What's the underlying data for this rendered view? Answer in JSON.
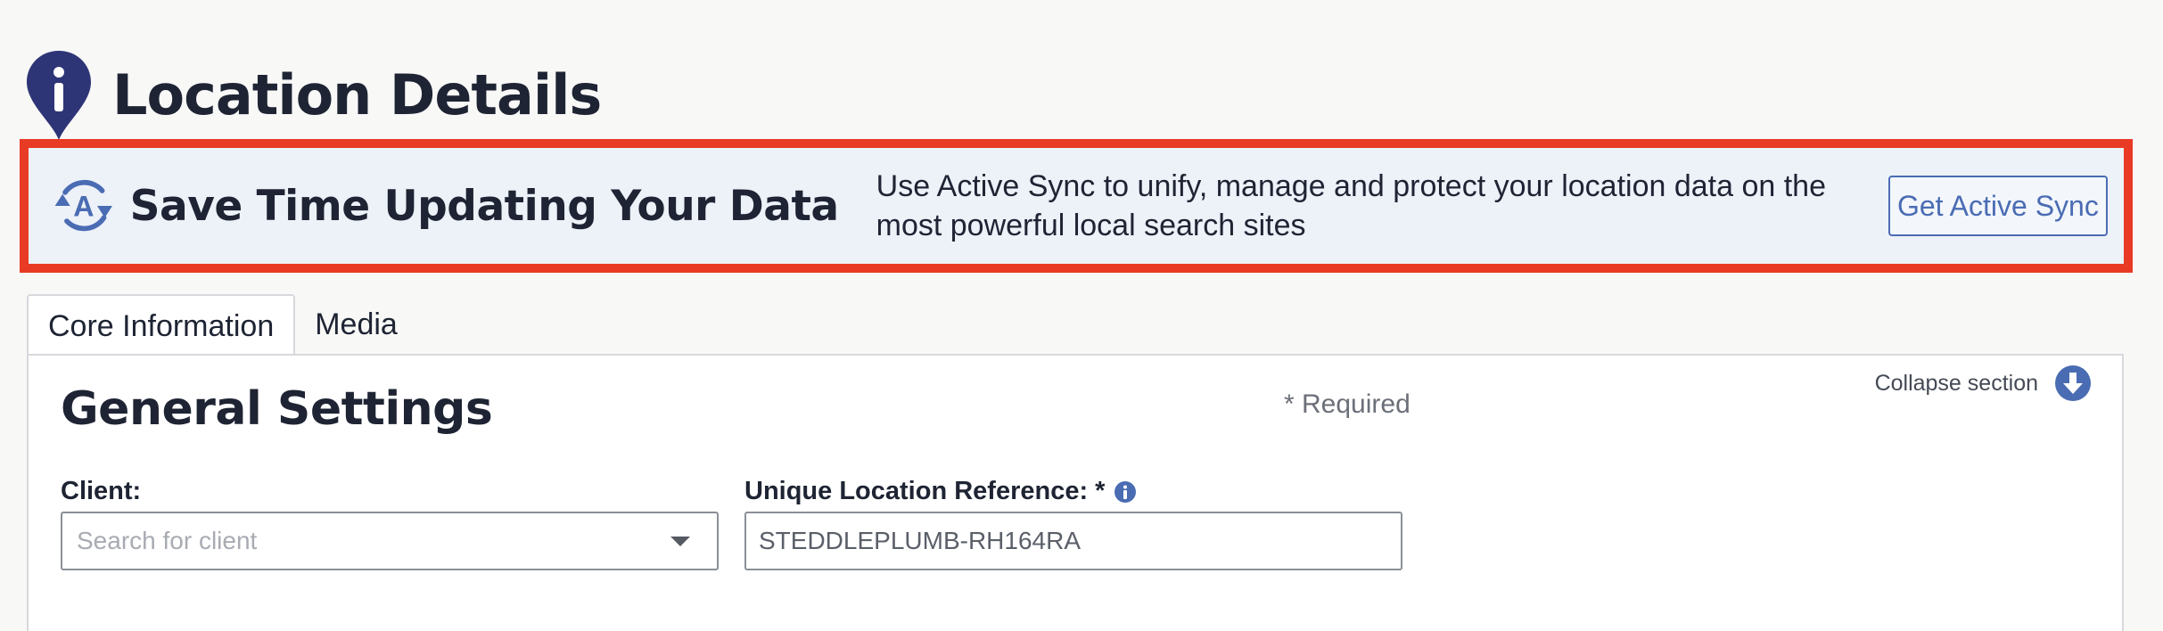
{
  "page": {
    "title": "Location Details"
  },
  "promo": {
    "title": "Save Time Updating Your Data",
    "text": "Use Active Sync to unify, manage and protect your location data on the most powerful local search sites",
    "button_label": "Get Active Sync"
  },
  "tabs": [
    {
      "label": "Core Information",
      "active": true
    },
    {
      "label": "Media",
      "active": false
    }
  ],
  "section": {
    "title": "General Settings",
    "required_note": "* Required",
    "collapse_label": "Collapse section"
  },
  "fields": {
    "client": {
      "label": "Client:",
      "placeholder": "Search for client"
    },
    "reference": {
      "label": "Unique Location Reference: *",
      "value": "STEDDLEPLUMB-RH164RA"
    }
  },
  "colors": {
    "accent": "#4a6cb3",
    "highlight_border": "#e83a24",
    "pin": "#2e3577",
    "promo_bg": "#edf1f8"
  },
  "icons": [
    "location-info-pin-icon",
    "active-sync-icon",
    "collapse-arrow-icon",
    "info-icon",
    "chevron-down-icon"
  ]
}
